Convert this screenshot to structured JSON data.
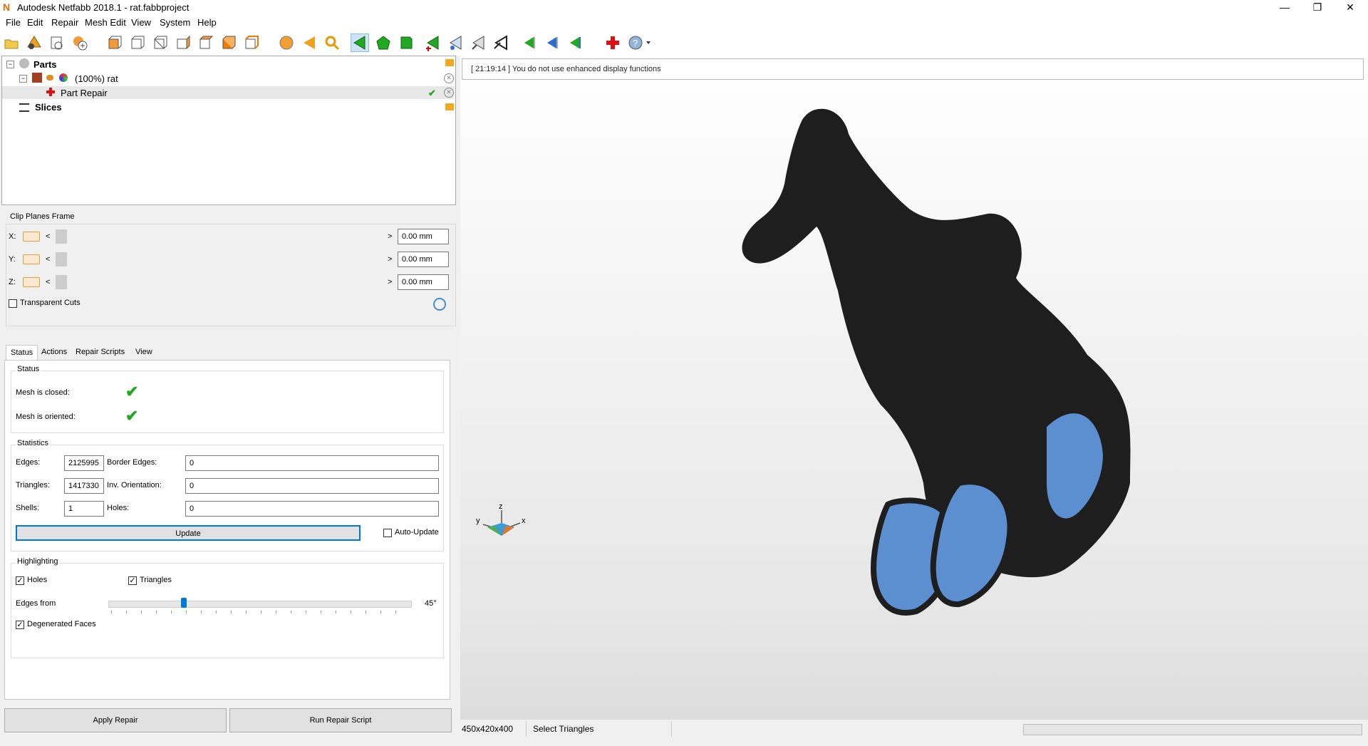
{
  "window": {
    "title": "Autodesk Netfabb 2018.1 - rat.fabbproject",
    "logo": "N"
  },
  "menu": [
    "File",
    "Edit",
    "Repair",
    "Mesh Edit",
    "View",
    "System",
    "Help"
  ],
  "toolbar_icons": [
    "open-folder-icon",
    "shapes-icon",
    "new-part-icon",
    "add-part-icon",
    "view-front-icon",
    "view-back-icon",
    "view-left-icon",
    "view-right-icon",
    "view-top-icon",
    "view-bottom-icon",
    "view-iso-icon",
    "sphere-icon",
    "arrow-left-icon",
    "zoom-icon",
    "select-triangle-icon",
    "select-shell-icon",
    "select-surface-icon",
    "add-triangle-icon",
    "pin-triangle-icon",
    "mark-triangle-icon",
    "cut-icon",
    "move-left-icon",
    "move-blue-icon",
    "move-up-icon",
    "repair-cross-icon",
    "help-icon"
  ],
  "tree": {
    "parts_label": "Parts",
    "part_label": "(100%) rat",
    "repair_label": "Part Repair",
    "slices_label": "Slices"
  },
  "clip": {
    "title": "Clip Planes Frame",
    "rows": [
      {
        "axis": "X:",
        "value": "0.00 mm"
      },
      {
        "axis": "Y:",
        "value": "0.00 mm"
      },
      {
        "axis": "Z:",
        "value": "0.00 mm"
      }
    ],
    "transparent_label": "Transparent Cuts"
  },
  "tabs": [
    "Status",
    "Actions",
    "Repair Scripts",
    "View"
  ],
  "status": {
    "title": "Status",
    "closed_label": "Mesh is closed:",
    "oriented_label": "Mesh is oriented:"
  },
  "stats": {
    "title": "Statistics",
    "edges_label": "Edges:",
    "edges": "2125995",
    "border_label": "Border Edges:",
    "border": "0",
    "triangles_label": "Triangles:",
    "triangles": "1417330",
    "inv_label": "Inv. Orientation:",
    "inv": "0",
    "shells_label": "Shells:",
    "shells": "1",
    "holes_label": "Holes:",
    "holes": "0",
    "update_label": "Update",
    "auto_update_label": "Auto-Update"
  },
  "highlight": {
    "title": "Highlighting",
    "holes_label": "Holes",
    "triangles_label": "Triangles",
    "edges_label": "Edges from",
    "edges_value": "45°",
    "edges_fraction": 0.25,
    "degenerated_label": "Degenerated Faces"
  },
  "buttons": {
    "apply": "Apply Repair",
    "run": "Run Repair Script"
  },
  "message": "[ 21:19:14 ] You do not use enhanced display functions",
  "axes": {
    "z": "z",
    "x": "x",
    "y": "y"
  },
  "statusbar": {
    "size": "450x420x400",
    "mode": "Select Triangles"
  },
  "colors": {
    "mesh": "#1e1e1e",
    "mesh_inner": "#5b8fcf",
    "accent": "#0078d7",
    "check": "#22a822"
  }
}
